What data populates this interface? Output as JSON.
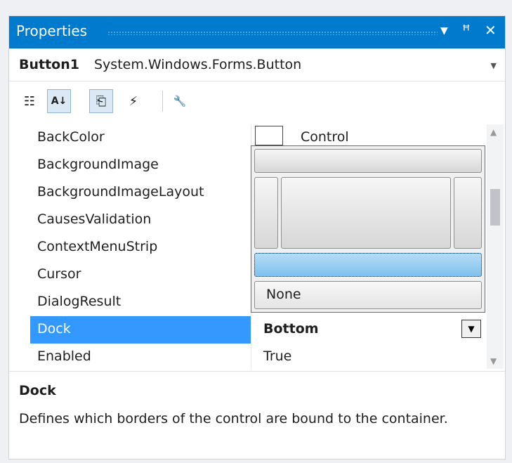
{
  "window": {
    "title": "Properties",
    "dropdown_glyph": "▼",
    "pin_glyph": "ꟸ",
    "close_glyph": "✕"
  },
  "object_selector": {
    "name": "Button1",
    "type": "System.Windows.Forms.Button",
    "dropdown_glyph": "▼"
  },
  "toolbar": {
    "icons": [
      "categorized-icon",
      "alphabetical-icon",
      "properties-icon",
      "events-icon",
      "property-pages-icon"
    ],
    "categorized_glyph": "☷",
    "alphabetical_glyph": "A↓",
    "properties_glyph": "⎗",
    "events_glyph": "⚡",
    "property_pages_glyph": "🔧"
  },
  "properties": [
    {
      "name": "BackColor",
      "value": "Control"
    },
    {
      "name": "BackgroundImage",
      "value": ""
    },
    {
      "name": "BackgroundImageLayout",
      "value": ""
    },
    {
      "name": "CausesValidation",
      "value": ""
    },
    {
      "name": "ContextMenuStrip",
      "value": ""
    },
    {
      "name": "Cursor",
      "value": ""
    },
    {
      "name": "DialogResult",
      "value": ""
    },
    {
      "name": "Dock",
      "value": "Bottom"
    },
    {
      "name": "Enabled",
      "value": "True"
    }
  ],
  "selected_property": "Dock",
  "dock_editor": {
    "options": [
      "Top",
      "Left",
      "Fill",
      "Right",
      "Bottom",
      "None"
    ],
    "selected": "Bottom",
    "none_label": "None"
  },
  "description": {
    "title": "Dock",
    "text": "Defines which borders of the control are bound to the container."
  },
  "colors": {
    "titlebar": "#007acc",
    "selection": "#3399ff",
    "dock_selected": "#7fc1ec"
  }
}
